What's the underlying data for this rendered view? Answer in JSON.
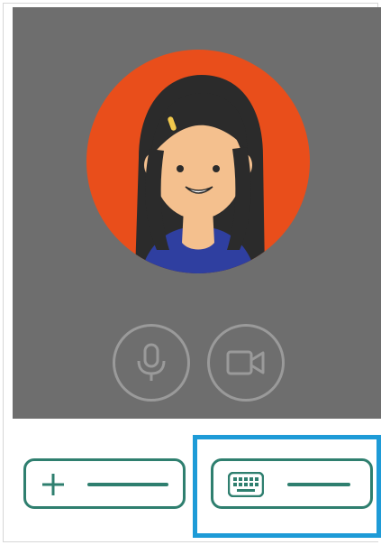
{
  "call": {
    "participant": {
      "avatar_icon": "person-avatar-icon"
    },
    "controls": {
      "microphone_icon": "microphone-icon",
      "camera_icon": "video-camera-icon"
    }
  },
  "bottom_bar": {
    "add_button_icon": "plus-icon",
    "keyboard_button_icon": "keyboard-icon"
  },
  "colors": {
    "video_background": "#6e6e6e",
    "avatar_circle": "#e94e1b",
    "control_outline": "#9a9a9a",
    "button_outline": "#2f7f6f",
    "selection_highlight": "#1e9bd7"
  }
}
